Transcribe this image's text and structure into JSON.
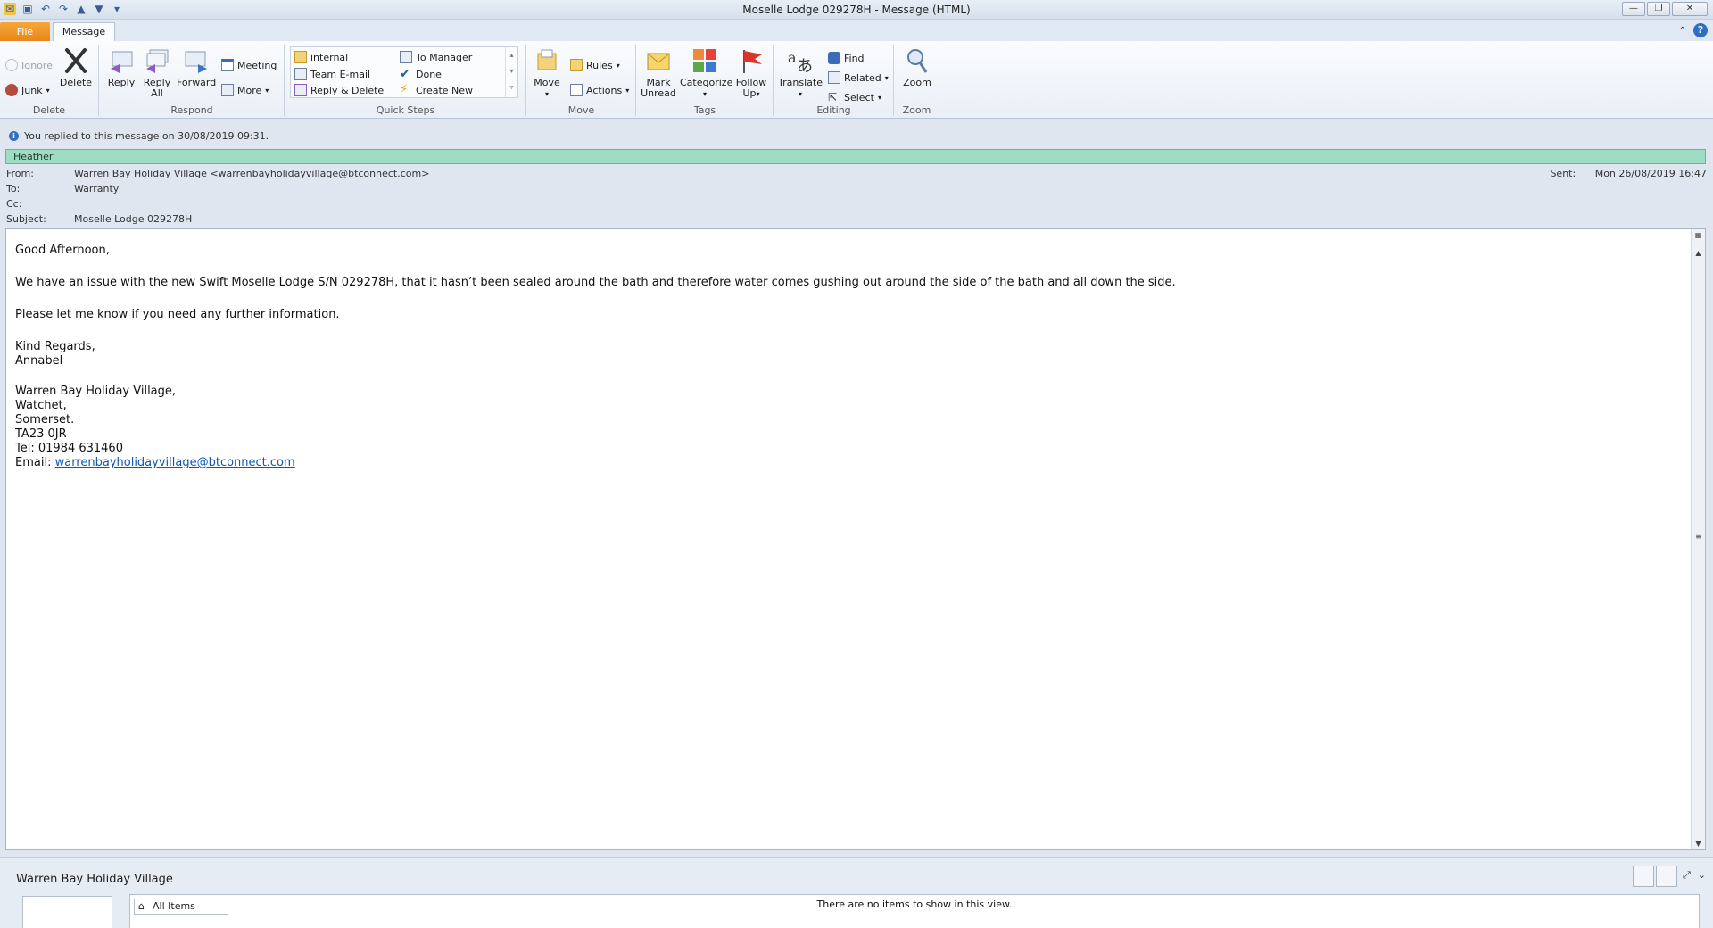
{
  "window": {
    "title": "Moselle Lodge 029278H  -  Message (HTML)"
  },
  "tabs": {
    "file": "File",
    "message": "Message"
  },
  "ribbon": {
    "delete": {
      "label": "Delete",
      "ignore": "Ignore",
      "junk": "Junk",
      "delete": "Delete"
    },
    "respond": {
      "label": "Respond",
      "reply": "Reply",
      "reply_all_1": "Reply",
      "reply_all_2": "All",
      "forward": "Forward",
      "meeting": "Meeting",
      "more": "More"
    },
    "quick_steps": {
      "label": "Quick Steps",
      "items": [
        "internal",
        "To Manager",
        "Team E-mail",
        "Done",
        "Reply & Delete",
        "Create New"
      ]
    },
    "move": {
      "label": "Move",
      "move": "Move",
      "rules": "Rules",
      "actions": "Actions"
    },
    "tags": {
      "label": "Tags",
      "mark_unread_1": "Mark",
      "mark_unread_2": "Unread",
      "categorize": "Categorize",
      "follow_up_1": "Follow",
      "follow_up_2": "Up"
    },
    "editing": {
      "label": "Editing",
      "translate": "Translate",
      "find": "Find",
      "related": "Related",
      "select": "Select"
    },
    "zoom": {
      "label": "Zoom",
      "zoom": "Zoom"
    }
  },
  "info_bar": "You replied to this message on 30/08/2019 09:31.",
  "category": "Heather",
  "headers": {
    "from_label": "From:",
    "from": "Warren Bay Holiday Village <warrenbayholidayvillage@btconnect.com>",
    "to_label": "To:",
    "to": "Warranty",
    "cc_label": "Cc:",
    "cc": "",
    "subject_label": "Subject:",
    "subject": "Moselle Lodge 029278H",
    "sent_label": "Sent:",
    "sent": "Mon 26/08/2019 16:47"
  },
  "body": {
    "greeting": "Good Afternoon,",
    "para1": "We have an issue with the new Swift Moselle Lodge S/N 029278H, that it hasn’t been sealed around the bath and therefore water comes gushing out around the side of the bath and all down the side.",
    "para2": "Please let me know if you need any further information.",
    "regards": "Kind Regards,",
    "name": "Annabel",
    "sig_company": "Warren Bay Holiday Village,",
    "sig_town": "Watchet,",
    "sig_county": "Somerset.",
    "sig_postcode": "TA23 0JR",
    "sig_tel": "Tel:  01984 631460",
    "sig_email_label": "Email: ",
    "sig_email": "warrenbayholidayvillage@btconnect.com"
  },
  "people_pane": {
    "name": "Warren Bay Holiday Village",
    "all_items": "All Items",
    "no_items": "There are no items to show in this view."
  },
  "colors": {
    "file_tab": "#e8861b",
    "category": "#9fdcc4",
    "link": "#0b58b8"
  }
}
